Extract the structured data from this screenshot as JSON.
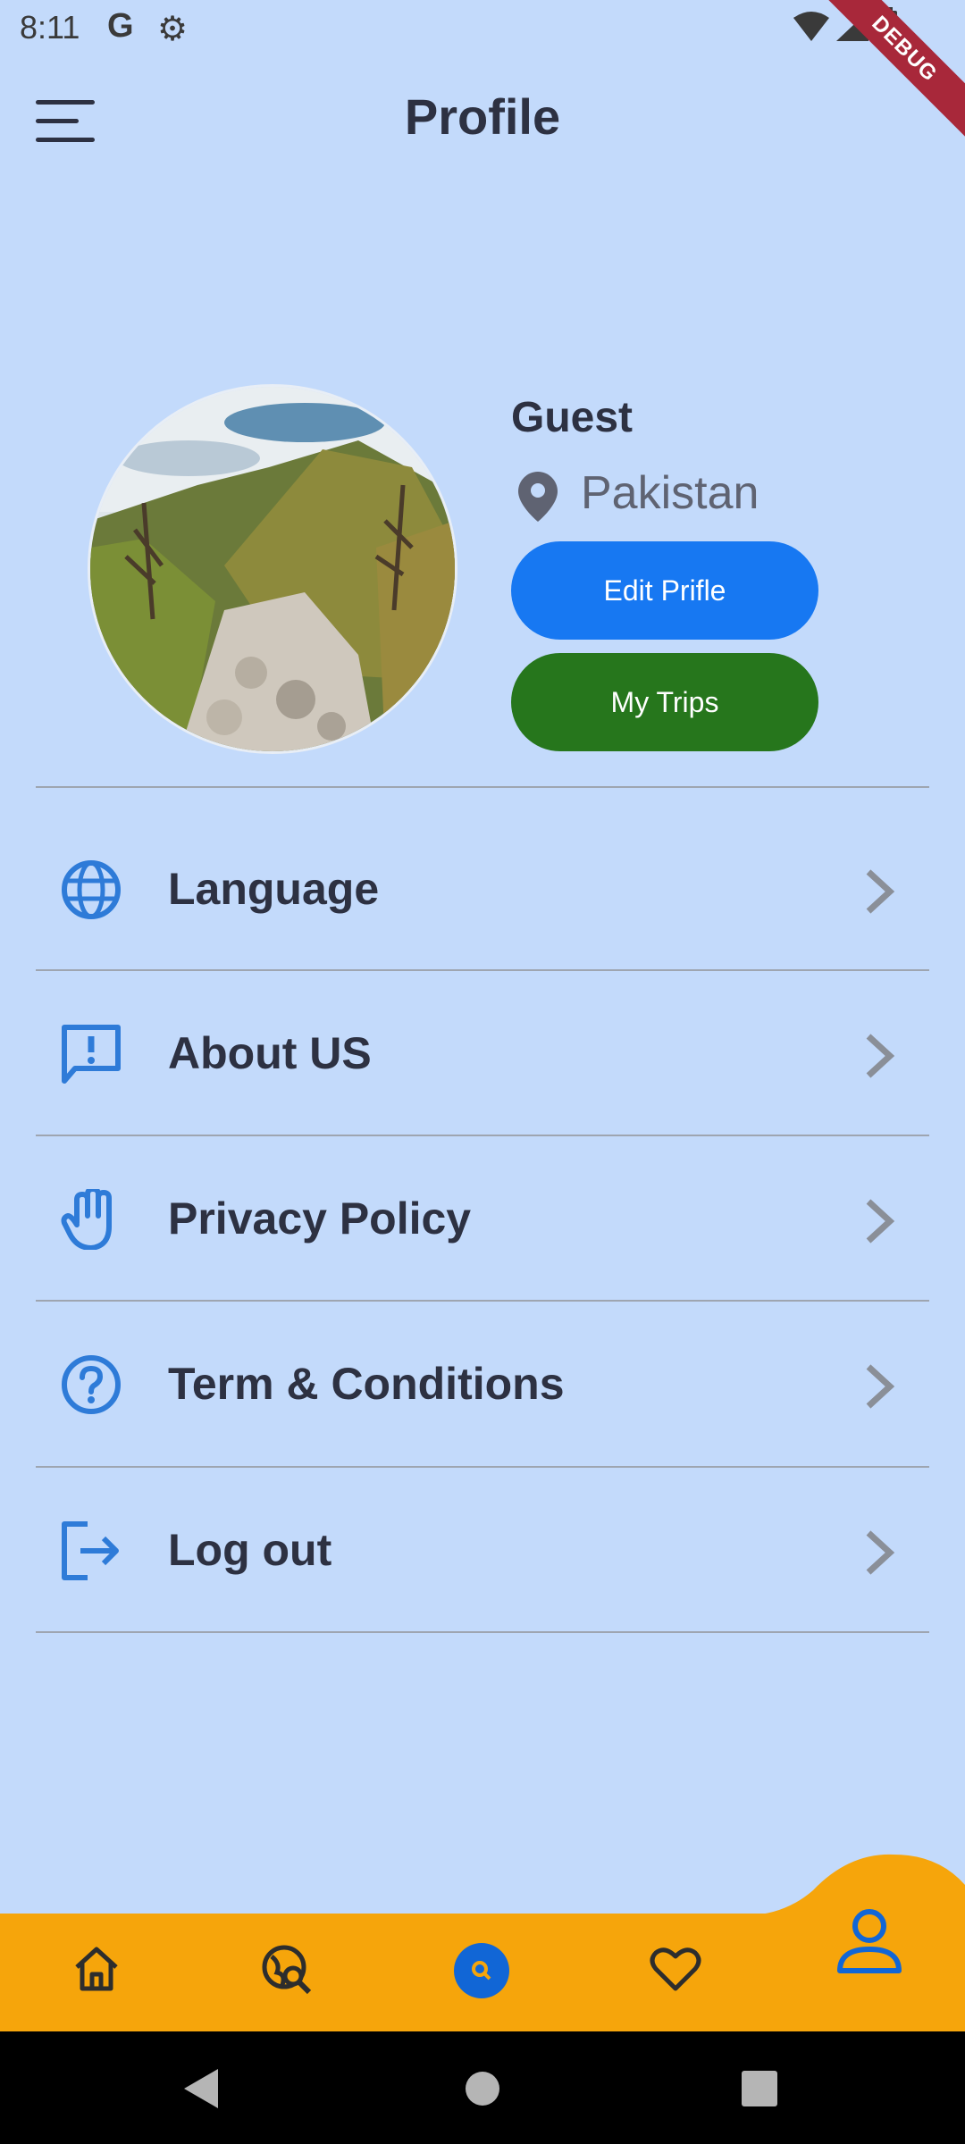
{
  "status_bar": {
    "time": "8:11",
    "g_label": "G",
    "debug_label": "DEBUG"
  },
  "header": {
    "title": "Profile"
  },
  "profile": {
    "name": "Guest",
    "location": "Pakistan",
    "edit_button": "Edit Prifle",
    "trips_button": "My Trips"
  },
  "menu": [
    {
      "label": "Language",
      "icon": "globe-icon"
    },
    {
      "label": "About US",
      "icon": "feedback-icon"
    },
    {
      "label": "Privacy Policy",
      "icon": "hand-icon"
    },
    {
      "label": "Term & Conditions",
      "icon": "help-circle-icon"
    },
    {
      "label": "Log out",
      "icon": "logout-icon"
    }
  ],
  "bottom_nav": {
    "items": [
      "home-icon",
      "travel-explore-icon",
      "search-icon",
      "heart-icon",
      "person-icon"
    ],
    "active": "person-icon",
    "background": "#f6a50b",
    "accent": "#1166d6"
  },
  "colors": {
    "background": "#c3dafb",
    "edit_button": "#1778f2",
    "trips_button": "#26761c",
    "icon_blue": "#2e7bd8"
  }
}
